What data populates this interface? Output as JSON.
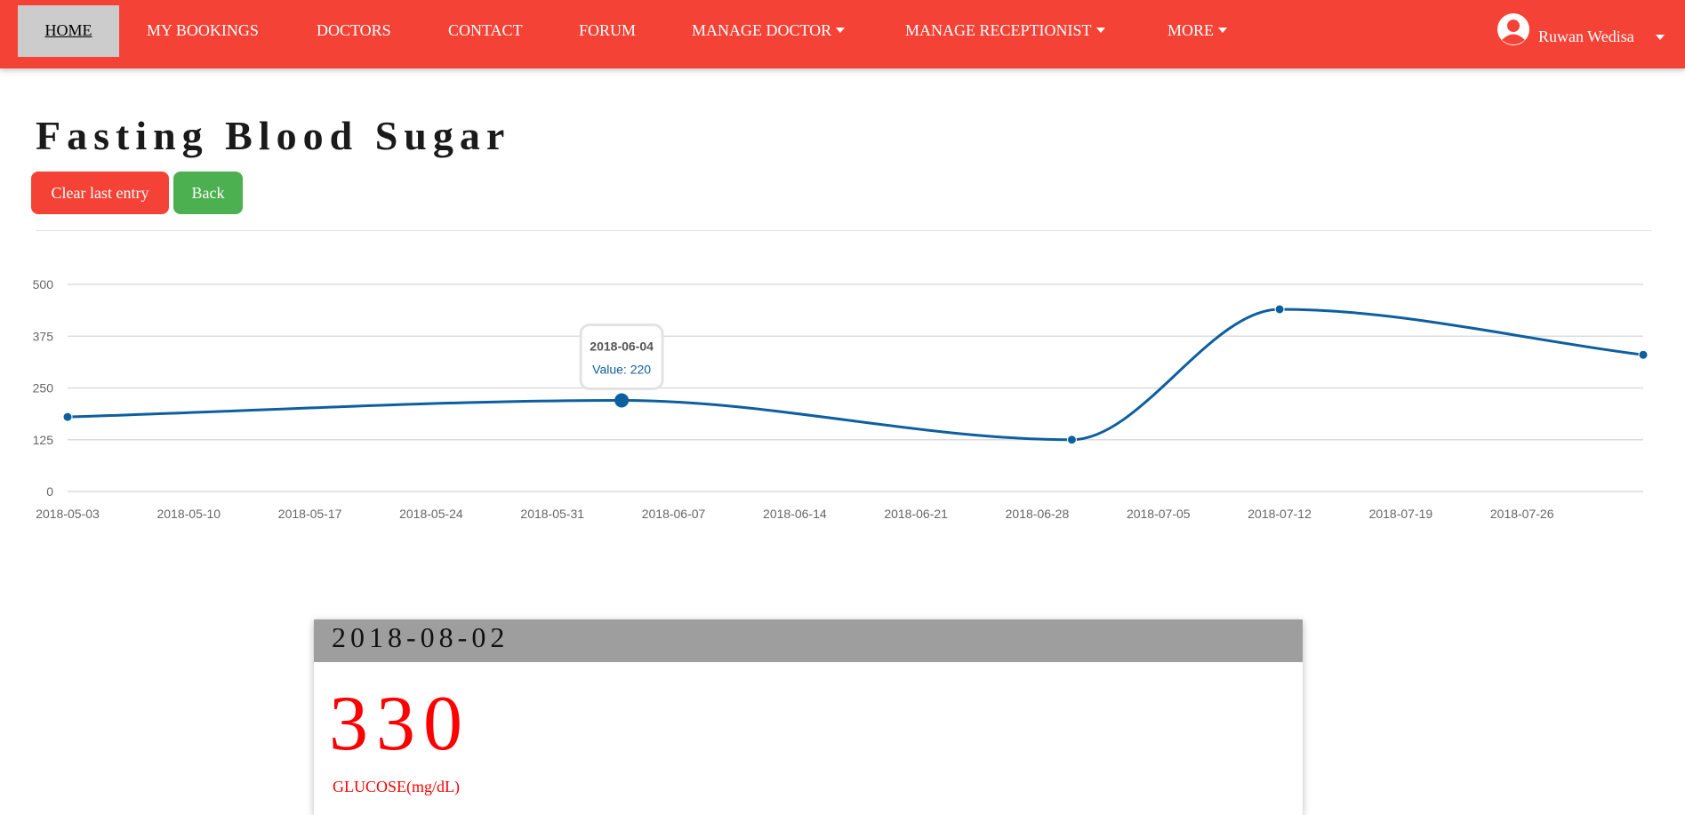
{
  "nav": {
    "items": [
      {
        "label": "HOME",
        "active": true,
        "dropdown": false
      },
      {
        "label": "MY BOOKINGS",
        "active": false,
        "dropdown": false
      },
      {
        "label": "DOCTORS",
        "active": false,
        "dropdown": false
      },
      {
        "label": "CONTACT",
        "active": false,
        "dropdown": false
      },
      {
        "label": "FORUM",
        "active": false,
        "dropdown": false
      },
      {
        "label": "MANAGE DOCTOR",
        "active": false,
        "dropdown": true
      },
      {
        "label": "MANAGE RECEPTIONIST",
        "active": false,
        "dropdown": true
      },
      {
        "label": "MORE",
        "active": false,
        "dropdown": true
      }
    ],
    "user": {
      "name": "Ruwan Wedisa",
      "icon": "user-avatar-icon"
    }
  },
  "page": {
    "title": "Fasting Blood Sugar",
    "buttons": {
      "clear": "Clear last entry",
      "back": "Back"
    }
  },
  "chart_data": {
    "type": "line",
    "x_ticks": [
      "2018-05-03",
      "2018-05-10",
      "2018-05-17",
      "2018-05-24",
      "2018-05-31",
      "2018-06-07",
      "2018-06-14",
      "2018-06-21",
      "2018-06-28",
      "2018-07-05",
      "2018-07-12",
      "2018-07-19",
      "2018-07-26"
    ],
    "x_range": [
      "2018-05-03",
      "2018-08-02"
    ],
    "y_ticks": [
      0,
      125,
      250,
      375,
      500
    ],
    "ylim": [
      0,
      500
    ],
    "grid": true,
    "series": [
      {
        "color": "#0e5fa0",
        "points": [
          {
            "x": "2018-05-03",
            "y": 180
          },
          {
            "x": "2018-06-04",
            "y": 220
          },
          {
            "x": "2018-06-30",
            "y": 125
          },
          {
            "x": "2018-07-12",
            "y": 440
          },
          {
            "x": "2018-08-02",
            "y": 330
          }
        ]
      }
    ],
    "tooltip": {
      "date": "2018-06-04",
      "label": "Value: 220"
    }
  },
  "latest": {
    "date": "2018-08-02",
    "value": "330",
    "unit": "GLUCOSE(mg/dL)"
  },
  "colors": {
    "nav_bg": "#f44336",
    "nav_active_bg": "#cccccc",
    "clear_button": "#f44336",
    "back_button": "#4caf50",
    "line": "#0e5fa0",
    "value_text": "#ff0000",
    "card_header": "#9e9e9e"
  }
}
